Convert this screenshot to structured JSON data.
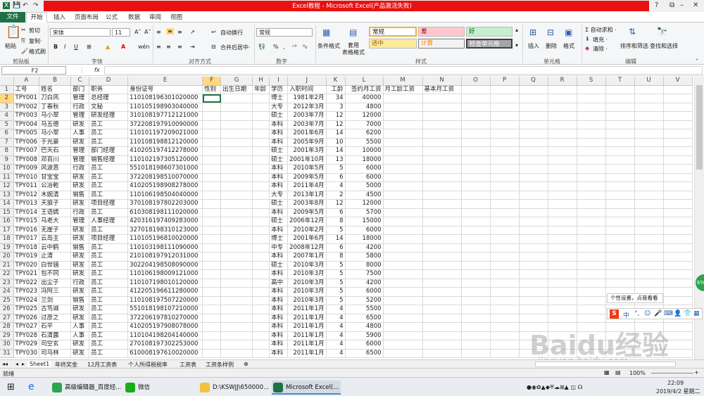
{
  "title": "Excel教程 - Microsoft Excel(产品激活失败)",
  "tabs": [
    "文件",
    "开始",
    "插入",
    "页面布局",
    "公式",
    "数据",
    "审阅",
    "视图"
  ],
  "clipboard": {
    "paste": "粘贴",
    "cut": "剪切",
    "copy": "复制·",
    "painter": "格式刷",
    "group": "剪贴板"
  },
  "font": {
    "name": "宋体",
    "size": "11",
    "bold": "B",
    "italic": "I",
    "underline": "U",
    "group": "字体",
    "wen": "wén"
  },
  "align": {
    "wrap": "自动换行",
    "merge": "合并后居中·",
    "group": "对齐方式"
  },
  "number": {
    "format": "常规",
    "group": "数字",
    "percent": "%"
  },
  "styles": {
    "cond": "条件格式",
    "table": "套用\n表格格式",
    "cells": [
      "常规",
      "差",
      "好",
      "适中",
      "计算",
      "检查单元格"
    ],
    "group": "样式"
  },
  "cellsgrp": {
    "insert": "插入",
    "delete": "删除",
    "format": "格式",
    "group": "单元格"
  },
  "editing": {
    "autosum": "Σ 自动求和 ·",
    "fill": "填充 ·",
    "clear": "清除 ·",
    "sort": "排序和筛选",
    "find": "查找和选择",
    "group": "编辑"
  },
  "formula_bar": {
    "name_box": "F2",
    "fx": "fx",
    "value": ""
  },
  "column_letters": [
    "A",
    "B",
    "C",
    "D",
    "E",
    "F",
    "G",
    "H",
    "I",
    "J",
    "K",
    "L",
    "M",
    "N",
    "O",
    "P",
    "Q",
    "R",
    "S",
    "T",
    "U",
    "V"
  ],
  "headers": [
    "工号",
    "姓名",
    "部门",
    "职务",
    "身份证号",
    "性别",
    "出生日期",
    "年龄",
    "学历",
    "入职时间",
    "工龄",
    "签约月工资",
    "月工龄工资",
    "基本月工资"
  ],
  "rows": [
    [
      "TPY001",
      "刀白凤",
      "管理",
      "总经理",
      "110108196301020000",
      "",
      "",
      "",
      "博士",
      "1981年2月",
      "34",
      "40000"
    ],
    [
      "TPY002",
      "丁春秋",
      "行政",
      "文秘",
      "110105198903040000",
      "",
      "",
      "",
      "大专",
      "2012年3月",
      "3",
      "4800"
    ],
    [
      "TPY003",
      "马小翠",
      "管理",
      "研发经理",
      "310108197712121000",
      "",
      "",
      "",
      "硕士",
      "2003年7月",
      "12",
      "12000"
    ],
    [
      "TPY004",
      "马五德",
      "研发",
      "员工",
      "372208197910090000",
      "",
      "",
      "",
      "本科",
      "2003年7月",
      "12",
      "7000"
    ],
    [
      "TPY005",
      "马小翠",
      "人事",
      "员工",
      "110101197209021000",
      "",
      "",
      "",
      "本科",
      "2001年6月",
      "14",
      "6200"
    ],
    [
      "TPY006",
      "于光豪",
      "研发",
      "员工",
      "110108198812120000",
      "",
      "",
      "",
      "本科",
      "2005年9月",
      "10",
      "5500"
    ],
    [
      "TPY007",
      "巴天石",
      "管理",
      "部门经理",
      "410205197412278000",
      "",
      "",
      "",
      "硕士",
      "2001年3月",
      "14",
      "10000"
    ],
    [
      "TPY008",
      "邓百川",
      "管理",
      "销售经理",
      "110102197305120000",
      "",
      "",
      "",
      "硕士",
      "2001年10月",
      "13",
      "18000"
    ],
    [
      "TPY009",
      "风波恶",
      "行政",
      "员工",
      "551018198607301000",
      "",
      "",
      "",
      "本科",
      "2010年5月",
      "5",
      "6000"
    ],
    [
      "TPY010",
      "甘宝宝",
      "研发",
      "员工",
      "372208198510070000",
      "",
      "",
      "",
      "本科",
      "2009年5月",
      "6",
      "6000"
    ],
    [
      "TPY011",
      "公冶乾",
      "研发",
      "员工",
      "410205198908278000",
      "",
      "",
      "",
      "本科",
      "2011年4月",
      "4",
      "5000"
    ],
    [
      "TPY012",
      "木婉清",
      "销售",
      "员工",
      "110106198504040000",
      "",
      "",
      "",
      "大专",
      "2013年1月",
      "2",
      "4500"
    ],
    [
      "TPY013",
      "天狼子",
      "研发",
      "项目经理",
      "370108197802203000",
      "",
      "",
      "",
      "硕士",
      "2003年8月",
      "12",
      "12000"
    ],
    [
      "TPY014",
      "王语嫣",
      "行政",
      "员工",
      "610308198111020000",
      "",
      "",
      "",
      "本科",
      "2009年5月",
      "6",
      "5700"
    ],
    [
      "TPY015",
      "乌老大",
      "管理",
      "人事经理",
      "420316197409283000",
      "",
      "",
      "",
      "硕士",
      "2006年12月",
      "8",
      "15000"
    ],
    [
      "TPY016",
      "无崖子",
      "研发",
      "员工",
      "327018198310123000",
      "",
      "",
      "",
      "本科",
      "2010年2月",
      "5",
      "6000"
    ],
    [
      "TPY017",
      "云岛主",
      "研发",
      "项目经理",
      "110105196810020000",
      "",
      "",
      "",
      "博士",
      "2001年6月",
      "14",
      "18000"
    ],
    [
      "TPY018",
      "云中鹤",
      "销售",
      "员工",
      "110103198111090000",
      "",
      "",
      "",
      "中专",
      "2008年12月",
      "6",
      "4200"
    ],
    [
      "TPY019",
      "止清",
      "研发",
      "员工",
      "210108197912031000",
      "",
      "",
      "",
      "本科",
      "2007年1月",
      "8",
      "5800"
    ],
    [
      "TPY020",
      "白世镜",
      "研发",
      "员工",
      "302204198508090000",
      "",
      "",
      "",
      "硕士",
      "2010年3月",
      "5",
      "8000"
    ],
    [
      "TPY021",
      "包不同",
      "研发",
      "员工",
      "110106198009121000",
      "",
      "",
      "",
      "本科",
      "2010年3月",
      "5",
      "7500"
    ],
    [
      "TPY022",
      "出尘子",
      "行政",
      "员工",
      "110107198010120000",
      "",
      "",
      "",
      "高中",
      "2010年3月",
      "5",
      "4200"
    ],
    [
      "TPY023",
      "冯阿三",
      "研发",
      "员工",
      "412205196611280000",
      "",
      "",
      "",
      "本科",
      "2010年3月",
      "5",
      "6000"
    ],
    [
      "TPY024",
      "兰剑",
      "销售",
      "员工",
      "110108197507220000",
      "",
      "",
      "",
      "本科",
      "2010年3月",
      "5",
      "5200"
    ],
    [
      "TPY025",
      "古笃诚",
      "研发",
      "员工",
      "551018198107210000",
      "",
      "",
      "",
      "本科",
      "2011年1月",
      "4",
      "5500"
    ],
    [
      "TPY026",
      "过彦之",
      "研发",
      "员工",
      "372206197810270000",
      "",
      "",
      "",
      "本科",
      "2011年1月",
      "4",
      "6500"
    ],
    [
      "TPY027",
      "石平",
      "人事",
      "员工",
      "410205197908078000",
      "",
      "",
      "",
      "本科",
      "2011年1月",
      "4",
      "4800"
    ],
    [
      "TPY028",
      "石清露",
      "人事",
      "员工",
      "110104198204140000",
      "",
      "",
      "",
      "本科",
      "2011年1月",
      "4",
      "5900"
    ],
    [
      "TPY029",
      "司空玄",
      "研发",
      "员工",
      "270108197302253000",
      "",
      "",
      "",
      "本科",
      "2011年1月",
      "4",
      "6000"
    ],
    [
      "TPY030",
      "司马林",
      "研发",
      "员工",
      "610008197610020000",
      "",
      "",
      "",
      "本科",
      "2011年1月",
      "4",
      "6500"
    ]
  ],
  "sheet_tabs": [
    "Sheet1",
    "年终奖金",
    "12月工资表",
    "个人所得税税率",
    "工资表",
    "工资条样例"
  ],
  "status": {
    "ready": "就绪",
    "zoom": "100%"
  },
  "sogou": {
    "tip": "个性设置，点我看看",
    "zh": "中",
    "pct": "6%"
  },
  "watermark": "Baidu经验",
  "watermark_url": "jingyan.baidu.com",
  "taskbar": {
    "items": [
      "高级编辑器_百度经...",
      "微信",
      "D:\\KSWJJ\\650000...",
      "Microsoft Excel(..."
    ],
    "time": "22:09",
    "date": "2019/4/2 星期二"
  }
}
